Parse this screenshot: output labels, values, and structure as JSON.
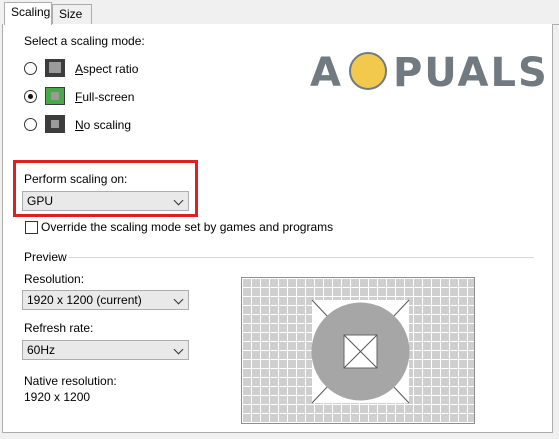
{
  "tabs": [
    {
      "label": "Scaling",
      "active": true
    },
    {
      "label": "Size",
      "active": false
    }
  ],
  "scaling_mode": {
    "heading": "Select a scaling mode:",
    "options": [
      {
        "label": "Aspect ratio",
        "selected": false,
        "icon": "aspect-ratio-icon"
      },
      {
        "label": "Full-screen",
        "selected": true,
        "icon": "full-screen-icon"
      },
      {
        "label": "No scaling",
        "selected": false,
        "icon": "no-scaling-icon"
      }
    ]
  },
  "perform_scaling": {
    "label": "Perform scaling on:",
    "selected": "GPU"
  },
  "override_checkbox": {
    "label": "Override the scaling mode set by games and programs",
    "checked": false
  },
  "preview": {
    "heading": "Preview",
    "resolution_label": "Resolution:",
    "resolution_value": "1920 x 1200 (current)",
    "refresh_label": "Refresh rate:",
    "refresh_value": "60Hz",
    "native_label": "Native resolution:",
    "native_value": "1920 x 1200"
  },
  "watermark": {
    "text": "APPUALS"
  },
  "colors": {
    "highlight_box": "#e02020",
    "radio_fill": "#111111"
  }
}
